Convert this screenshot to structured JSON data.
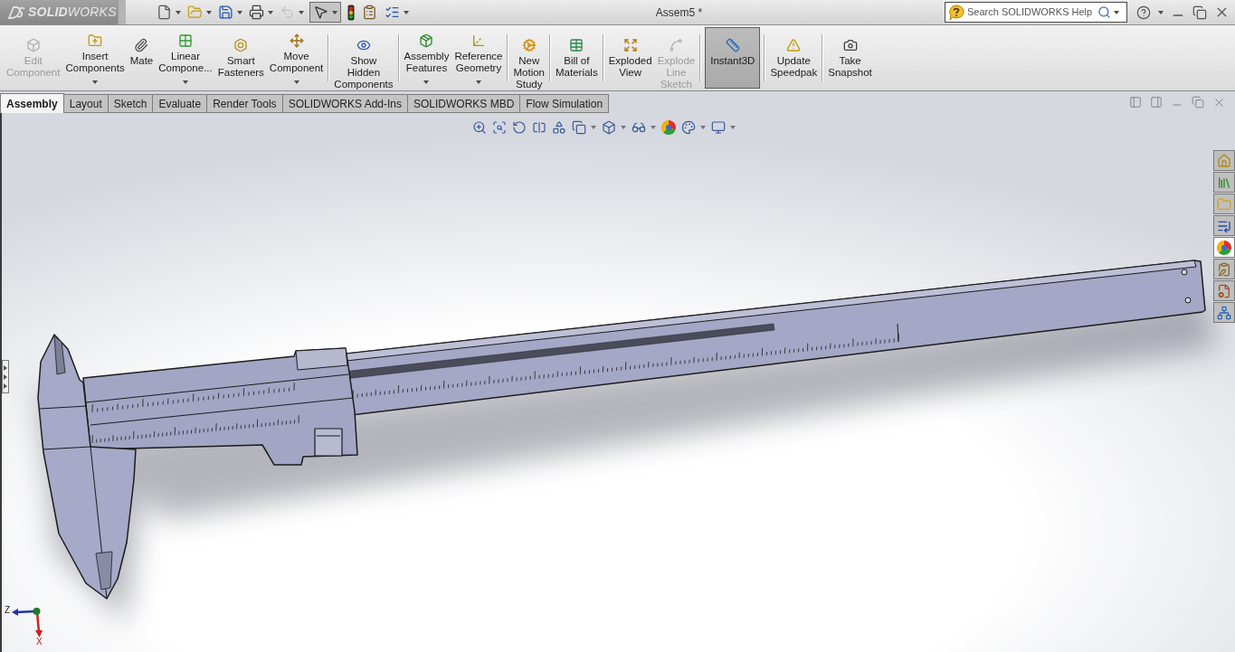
{
  "app": {
    "logo": "**SOLID**WORKS"
  },
  "quick_access": [
    {
      "dropdown": true,
      "pressed": false,
      "disabled": false
    },
    {
      "dropdown": true,
      "pressed": false,
      "disabled": false
    },
    {
      "dropdown": true,
      "pressed": false,
      "disabled": false
    },
    {
      "dropdown": true,
      "pressed": false,
      "disabled": false
    },
    {
      "dropdown": true,
      "pressed": false,
      "disabled": true
    },
    {
      "dropdown": true,
      "pressed": true,
      "disabled": false
    },
    {
      "dropdown": false,
      "pressed": false,
      "disabled": false
    },
    {
      "dropdown": false,
      "pressed": false,
      "disabled": false
    },
    {
      "dropdown": true,
      "pressed": false,
      "disabled": false
    }
  ],
  "window": {
    "title": "Assem5 *"
  },
  "search": {
    "placeholder": "Search SOLIDWORKS Help"
  },
  "ribbon": {
    "groups": [
      {
        "buttons": [
          {
            "label": "Edit\nComponent",
            "disabled": true,
            "dropdown": false,
            "on": false
          },
          {
            "label": "Insert\nComponents",
            "disabled": false,
            "dropdown": true,
            "on": false
          },
          {
            "label": "Mate",
            "disabled": false,
            "dropdown": false,
            "on": false
          },
          {
            "label": "Linear\nCompone...",
            "disabled": false,
            "dropdown": true,
            "on": false
          },
          {
            "label": "Smart\nFasteners",
            "disabled": false,
            "dropdown": false,
            "on": false
          },
          {
            "label": "Move\nComponent",
            "disabled": false,
            "dropdown": true,
            "on": false
          }
        ]
      },
      {
        "buttons": [
          {
            "label": "Show\nHidden\nComponents",
            "disabled": false,
            "dropdown": false,
            "on": false
          }
        ]
      },
      {
        "buttons": [
          {
            "label": "Assembly\nFeatures",
            "disabled": false,
            "dropdown": true,
            "on": false
          },
          {
            "label": "Reference\nGeometry",
            "disabled": false,
            "dropdown": true,
            "on": false
          }
        ]
      },
      {
        "buttons": [
          {
            "label": "New\nMotion\nStudy",
            "disabled": false,
            "dropdown": false,
            "on": false
          }
        ]
      },
      {
        "buttons": [
          {
            "label": "Bill of\nMaterials",
            "disabled": false,
            "dropdown": false,
            "on": false
          }
        ]
      },
      {
        "buttons": [
          {
            "label": "Exploded\nView",
            "disabled": false,
            "dropdown": false,
            "on": false
          },
          {
            "label": "Explode\nLine\nSketch",
            "disabled": true,
            "dropdown": false,
            "on": false
          }
        ]
      },
      {
        "buttons": [
          {
            "label": "Instant3D",
            "disabled": false,
            "dropdown": false,
            "on": true
          }
        ]
      },
      {
        "buttons": [
          {
            "label": "Update\nSpeedpak",
            "disabled": false,
            "dropdown": false,
            "on": false
          }
        ]
      },
      {
        "buttons": [
          {
            "label": "Take\nSnapshot",
            "disabled": false,
            "dropdown": false,
            "on": false
          }
        ]
      }
    ]
  },
  "tabs": [
    {
      "label": "Assembly",
      "selected": true
    },
    {
      "label": "Layout",
      "selected": false
    },
    {
      "label": "Sketch",
      "selected": false
    },
    {
      "label": "Evaluate",
      "selected": false
    },
    {
      "label": "Render Tools",
      "selected": false
    },
    {
      "label": "SOLIDWORKS Add-Ins",
      "selected": false
    },
    {
      "label": "SOLIDWORKS MBD",
      "selected": false
    },
    {
      "label": "Flow Simulation",
      "selected": false
    }
  ],
  "task_pane_tabs": [
    {
      "selected": false
    },
    {
      "selected": false
    },
    {
      "selected": false
    },
    {
      "selected": false
    },
    {
      "selected": true
    },
    {
      "selected": false
    },
    {
      "selected": false
    },
    {
      "selected": false
    }
  ],
  "triad": {
    "z_label": "Z",
    "x_label": "X"
  }
}
